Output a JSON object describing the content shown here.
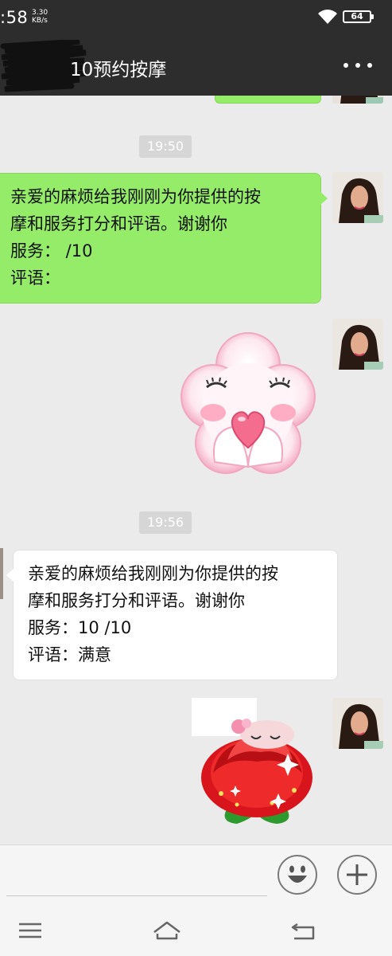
{
  "status_bar": {
    "time": ":58",
    "net_speed_value": "3.30",
    "net_speed_unit": "KB/s",
    "battery": "64"
  },
  "title_bar": {
    "title": "10预约按摩"
  },
  "messages": {
    "ts1": "19:50",
    "sent": [
      "亲爱的麻烦给我刚刚为你提供的按",
      "摩和服务打分和评语。谢谢你",
      "服务：  /10",
      "评语："
    ],
    "ts2": "19:56",
    "received": [
      "亲爱的麻烦给我刚刚为你提供的按",
      "摩和服务打分和评语。谢谢你",
      "服务：10 /10",
      "评语：满意"
    ]
  },
  "icons": {
    "more": "more-dots-icon",
    "emoji": "emoji-icon",
    "plus": "plus-icon",
    "menu": "menu-icon",
    "home": "home-icon",
    "back": "back-icon"
  },
  "colors": {
    "bar": "#2d2d2d",
    "bubble_green": "#95ec69",
    "chat_bg": "#ebebeb"
  }
}
